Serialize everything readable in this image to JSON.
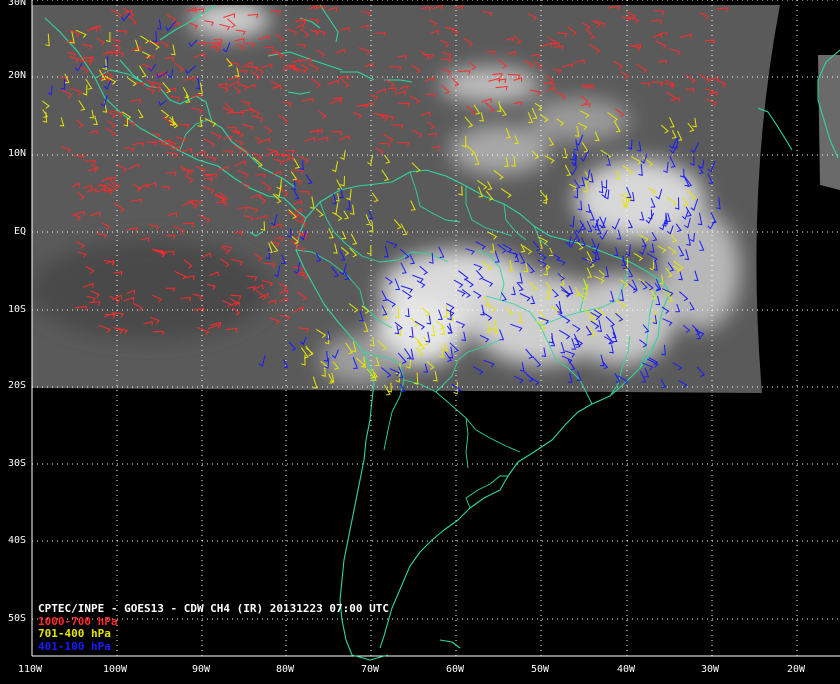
{
  "map": {
    "caption": "CPTEC/INPE - GOES13 - CDW CH4 (IR) 20131223 07:00 UTC",
    "legend": [
      {
        "label": "1000-700 hPa",
        "color": "#ff2a2a"
      },
      {
        "label": "701-400 hPa",
        "color": "#e6e600"
      },
      {
        "label": "401-100 hPa",
        "color": "#1a1aff"
      }
    ],
    "lat_ticks": [
      "30N",
      "20N",
      "10N",
      "EQ",
      "10S",
      "20S",
      "30S",
      "40S",
      "50S"
    ],
    "lon_ticks": [
      "110W",
      "100W",
      "90W",
      "80W",
      "70W",
      "60W",
      "50W",
      "40W",
      "30W",
      "20W"
    ],
    "coastline_color": "#2fd6a0",
    "grid_color": "#ffffff",
    "extent": {
      "lon": [
        "110W",
        "20W"
      ],
      "lat": [
        "55S",
        "30N"
      ]
    }
  }
}
